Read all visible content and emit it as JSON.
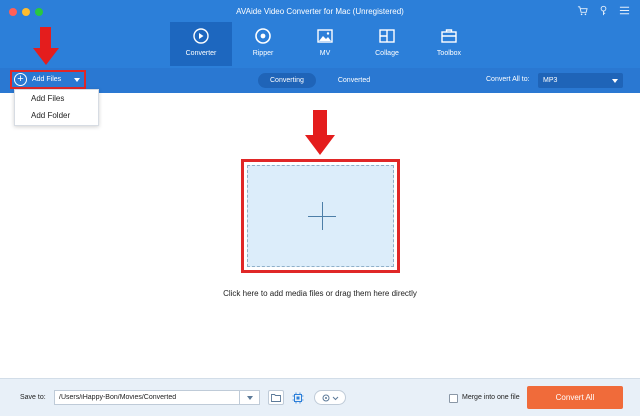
{
  "window": {
    "title": "AVAide Video Converter for Mac (Unregistered)",
    "top_icons": [
      "cart-icon",
      "key-icon",
      "menu-icon"
    ]
  },
  "tabs": [
    {
      "label": "Converter",
      "icon": "converter-icon",
      "active": true
    },
    {
      "label": "Ripper",
      "icon": "disc-icon",
      "active": false
    },
    {
      "label": "MV",
      "icon": "image-icon",
      "active": false
    },
    {
      "label": "Collage",
      "icon": "collage-icon",
      "active": false
    },
    {
      "label": "Toolbox",
      "icon": "toolbox-icon",
      "active": false
    }
  ],
  "toolbar": {
    "add_files_label": "Add Files",
    "converting_label": "Converting",
    "converted_label": "Converted",
    "convert_all_to_label": "Convert All to:",
    "format_value": "MP3"
  },
  "dropdown": {
    "items": [
      "Add Files",
      "Add Folder"
    ]
  },
  "main": {
    "hint": "Click here to add media files or drag them here directly"
  },
  "footer": {
    "save_to_label": "Save to:",
    "path_value": "/Users/iHappy-Bon/Movies/Converted",
    "merge_label": "Merge into one file",
    "merge_checked": false,
    "convert_all_label": "Convert All"
  },
  "colors": {
    "header_blue": "#2c7fd9",
    "toolbar_blue": "#2a78d2",
    "highlight_red": "#e02727",
    "drop_zone": "#dcedfa",
    "convert_orange": "#f06b3a"
  }
}
